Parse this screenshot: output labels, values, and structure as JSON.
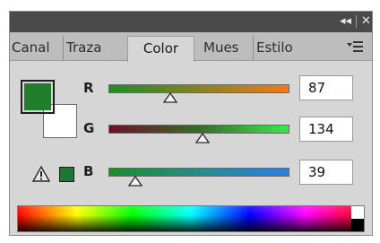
{
  "titlebar": {
    "collapse_glyph": "◂◂",
    "close_glyph": "✕"
  },
  "tabs": [
    {
      "label": "Canal"
    },
    {
      "label": "Traza"
    },
    {
      "label": "Color",
      "active": true
    },
    {
      "label": "Mues"
    },
    {
      "label": "Estilo"
    }
  ],
  "colors": {
    "foreground": "#1f7d2b",
    "background": "#ffffff",
    "gamut_swatch": "#1a7a32"
  },
  "channels": [
    {
      "label": "R",
      "value": "87",
      "fraction": 0.34
    },
    {
      "label": "G",
      "value": "134",
      "fraction": 0.52
    },
    {
      "label": "B",
      "value": "39",
      "fraction": 0.15
    }
  ],
  "icons": {
    "gamut_warning": "warning-triangle-icon",
    "panel_menu": "panel-menu-icon"
  }
}
